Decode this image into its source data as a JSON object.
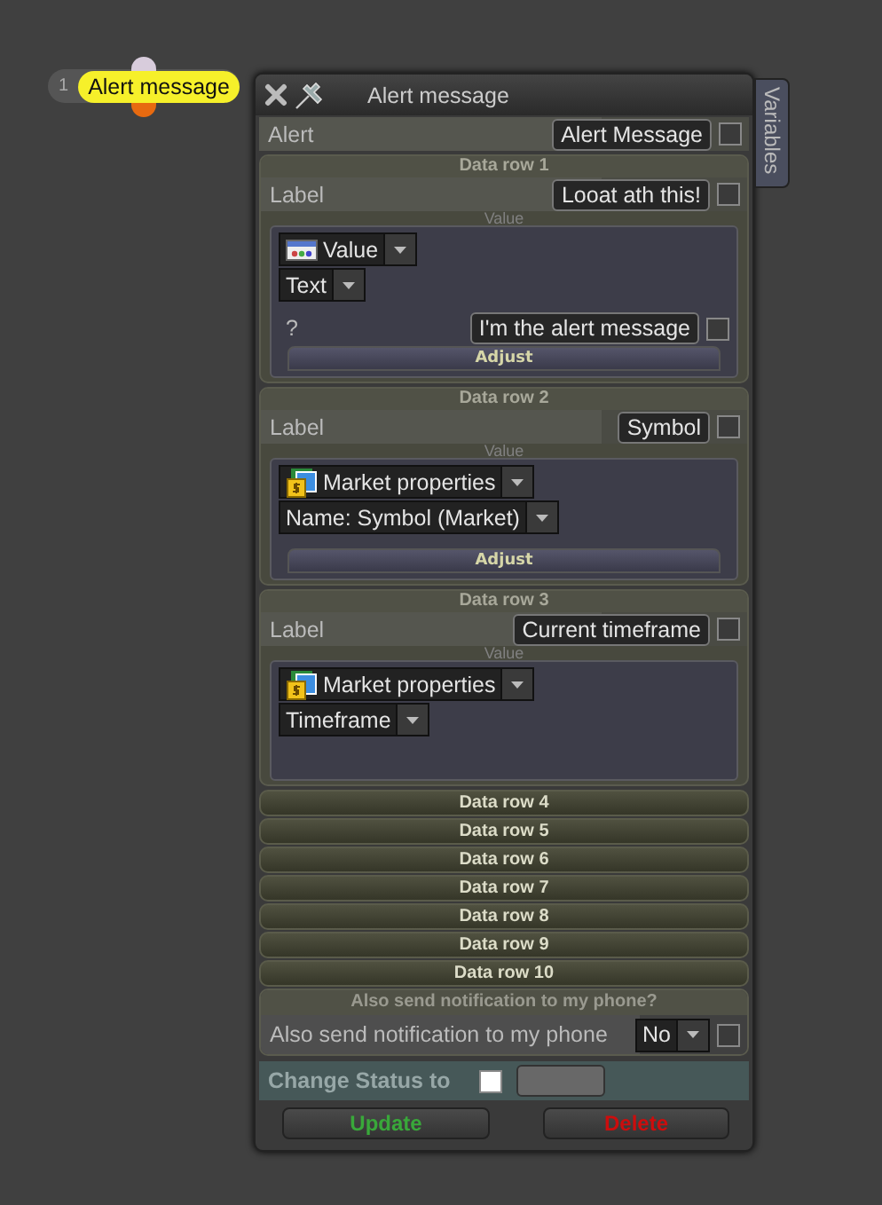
{
  "node": {
    "number": "1",
    "label": "Alert message"
  },
  "side_tab": {
    "label": "Variables"
  },
  "dialog": {
    "title": "Alert message",
    "alert": {
      "label": "Alert",
      "value": "Alert Message",
      "checked": false
    },
    "data_rows": [
      {
        "header": "Data row 1",
        "expanded": true,
        "label": "Label",
        "label_value": "Looat ath this!",
        "checked": false,
        "value_caption": "Value",
        "dropdowns": [
          {
            "kind": "value",
            "text": "Value"
          },
          {
            "kind": "plain",
            "text": "Text"
          }
        ],
        "param": {
          "label": "?",
          "value": "I'm the alert message",
          "checked": false
        },
        "button": "Adjust"
      },
      {
        "header": "Data row 2",
        "expanded": true,
        "label": "Label",
        "label_value": "Symbol",
        "checked": false,
        "value_caption": "Value",
        "dropdowns": [
          {
            "kind": "market",
            "text": "Market properties"
          },
          {
            "kind": "plain",
            "text": "Name: Symbol (Market)"
          }
        ],
        "button": "Adjust"
      },
      {
        "header": "Data row 3",
        "expanded": true,
        "label": "Label",
        "label_value": "Current timeframe",
        "checked": false,
        "value_caption": "Value",
        "dropdowns": [
          {
            "kind": "market",
            "text": "Market properties"
          },
          {
            "kind": "plain",
            "text": "Timeframe"
          }
        ]
      },
      {
        "header": "Data row 4",
        "expanded": false
      },
      {
        "header": "Data row 5",
        "expanded": false
      },
      {
        "header": "Data row 6",
        "expanded": false
      },
      {
        "header": "Data row 7",
        "expanded": false
      },
      {
        "header": "Data row 8",
        "expanded": false
      },
      {
        "header": "Data row 9",
        "expanded": false
      },
      {
        "header": "Data row 10",
        "expanded": false
      }
    ],
    "notification": {
      "header": "Also send notification to my phone?",
      "label": "Also send notification to my phone",
      "value": "No",
      "checked": false
    },
    "status": {
      "label": "Change Status to",
      "checked": false
    },
    "buttons": [
      {
        "kind": "update",
        "label": "Update"
      },
      {
        "kind": "delete",
        "label": "Delete"
      }
    ]
  }
}
